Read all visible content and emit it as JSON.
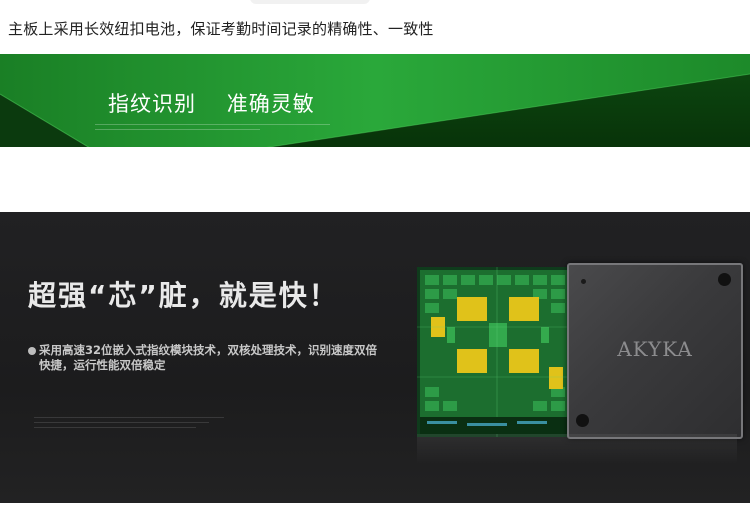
{
  "top": {
    "caption": "主板上采用长效纽扣电池，保证考勤时间记录的精确性、一致性"
  },
  "banner": {
    "title": "指纹识别    准确灵敏"
  },
  "feature": {
    "headline": "超强“芯”脏，就是快！",
    "bullet": "采用高速32位嵌入式指纹模块技术，双核处理技术，识别速度双倍快捷，运行性能双倍稳定"
  },
  "chip": {
    "brand": "AKYKA"
  },
  "colors": {
    "banner_green": "#1f9a2e",
    "banner_dark": "#0f4a12",
    "panel_dark": "#1e1e1f"
  }
}
